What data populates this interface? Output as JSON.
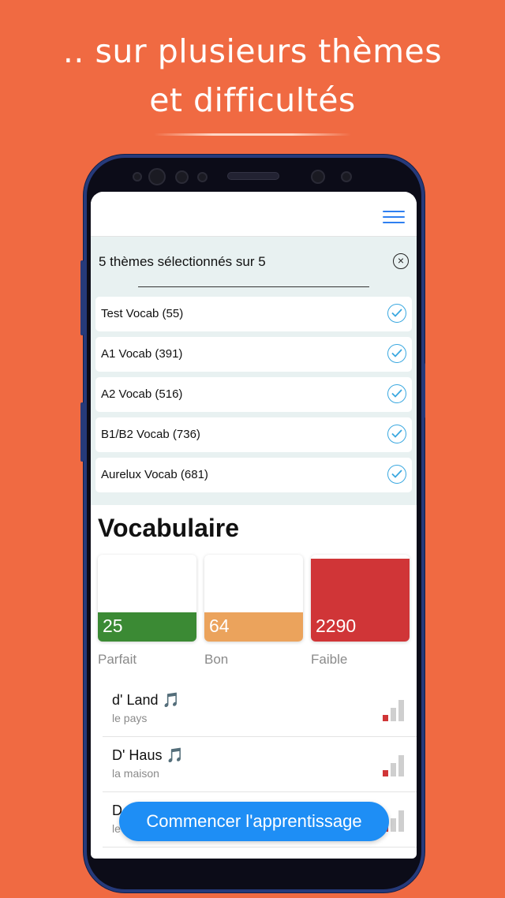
{
  "headline": {
    "line1": ".. sur plusieurs thèmes",
    "line2": "et difficultés"
  },
  "topbar": {
    "menu_icon": "hamburger-menu-icon",
    "accent": "#2f7ff0"
  },
  "themes": {
    "header": "5 thèmes sélectionnés sur 5",
    "close_icon": "close-circle-icon",
    "items": [
      {
        "label": "Test Vocab (55)",
        "selected": true
      },
      {
        "label": "A1 Vocab (391)",
        "selected": true
      },
      {
        "label": "A2 Vocab (516)",
        "selected": true
      },
      {
        "label": "B1/B2 Vocab (736)",
        "selected": true
      },
      {
        "label": "Aurelux Vocab (681)",
        "selected": true
      }
    ]
  },
  "vocab": {
    "title": "Vocabulaire",
    "stats": [
      {
        "value": "25",
        "label": "Parfait",
        "color": "#3b8a34",
        "fill": 0.35
      },
      {
        "value": "64",
        "label": "Bon",
        "color": "#eba35c",
        "fill": 0.35
      },
      {
        "value": "2290",
        "label": "Faible",
        "color": "#d03537",
        "fill": 1.0
      }
    ],
    "words": [
      {
        "word": "d' Land 🎵",
        "translation": "le pays",
        "level_icon": "signal-level-low-icon"
      },
      {
        "word": "D' Haus 🎵",
        "translation": "la maison",
        "level_icon": "signal-level-low-icon"
      },
      {
        "word": "D",
        "translation": "le",
        "level_icon": "signal-level-low-icon"
      }
    ]
  },
  "cta": {
    "label": "Commencer l'apprentissage",
    "color": "#1e8ef5"
  }
}
